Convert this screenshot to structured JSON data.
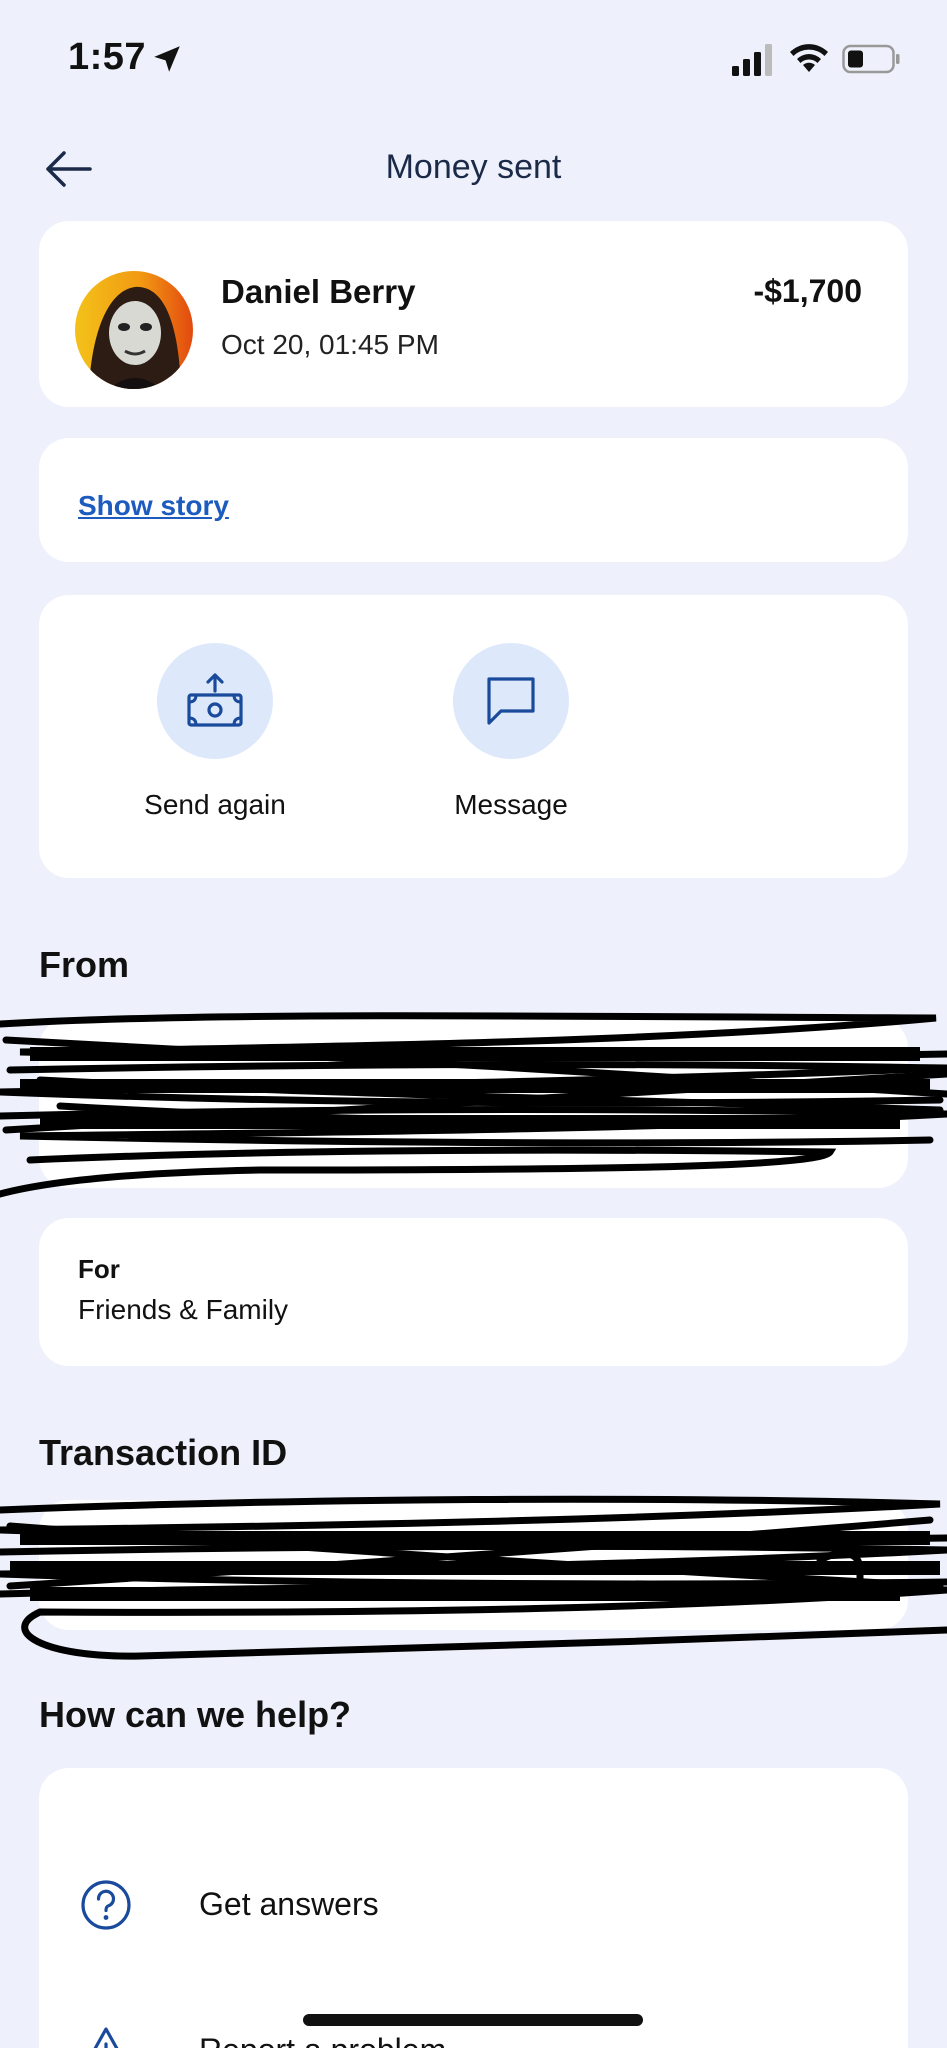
{
  "status_bar": {
    "time": "1:57",
    "icons": [
      "location-arrow-icon",
      "cellular-signal-icon",
      "wifi-icon",
      "battery-icon"
    ]
  },
  "nav": {
    "title": "Money sent",
    "back_icon": "arrow-left-icon"
  },
  "payee": {
    "name": "Daniel Berry",
    "date": "Oct 20, 01:45 PM",
    "amount": "-$1,700"
  },
  "story": {
    "link_label": "Show story"
  },
  "actions": [
    {
      "label": "Send again",
      "icon": "send-money-icon"
    },
    {
      "label": "Message",
      "icon": "message-icon"
    }
  ],
  "from": {
    "heading": "From"
  },
  "purpose": {
    "label": "For",
    "value": "Friends & Family"
  },
  "transaction": {
    "heading": "Transaction ID"
  },
  "help": {
    "heading": "How can we help?",
    "items": [
      {
        "label": "Get answers",
        "icon": "question-circle-icon"
      },
      {
        "label": "Report a problem",
        "icon": "warning-triangle-icon"
      }
    ]
  },
  "colors": {
    "background": "#eef1fb",
    "card": "#ffffff",
    "link": "#1d5bbf",
    "icon_blue": "#1a4a9c",
    "icon_circle": "#dde9fb"
  }
}
